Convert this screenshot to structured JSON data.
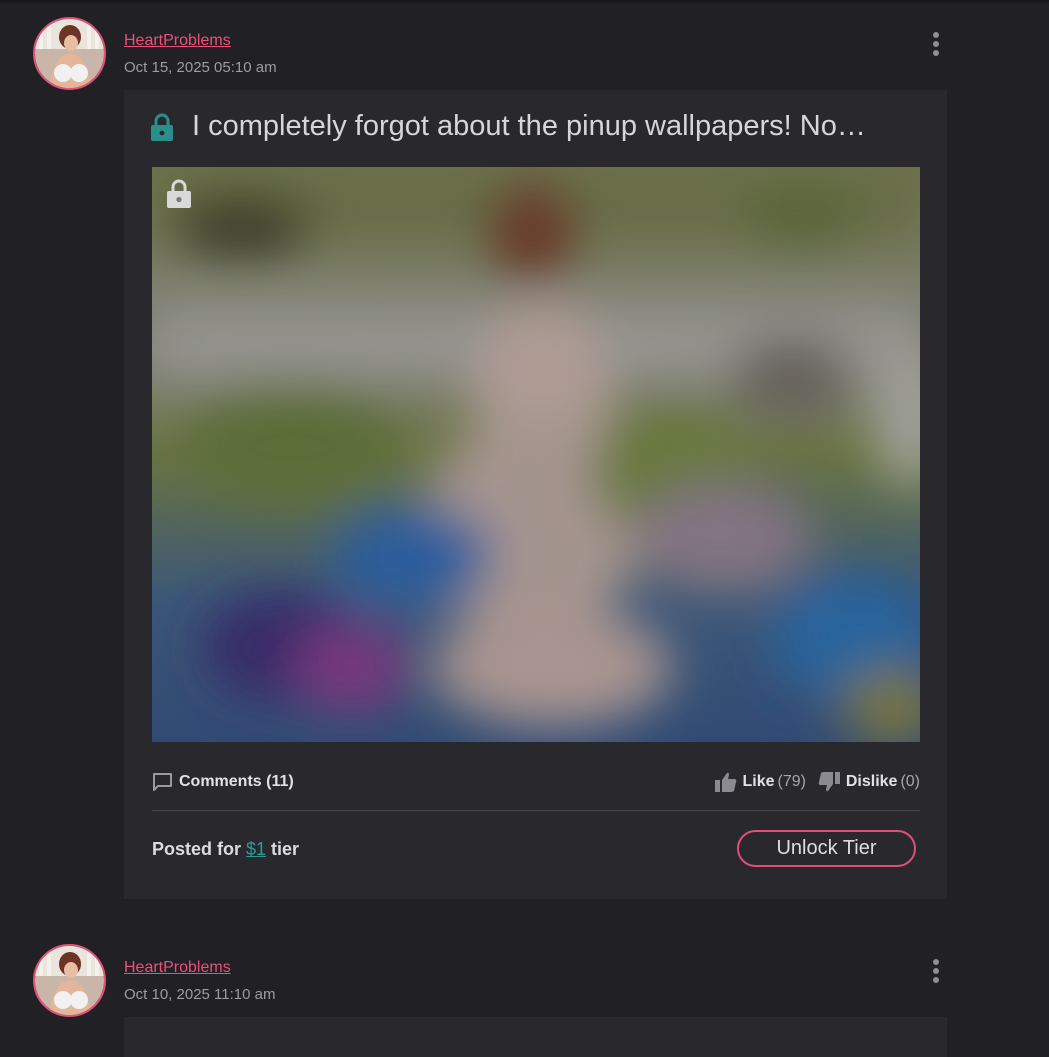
{
  "posts": [
    {
      "author": "HeartProblems",
      "date": "Oct 15, 2025 05:10 am",
      "title": "I completely forgot about the pinup wallpapers! No…",
      "comments_label": "Comments (11)",
      "like_label": "Like",
      "like_count": "(79)",
      "dislike_label": "Dislike",
      "dislike_count": "(0)",
      "posted_for_prefix": "Posted for ",
      "tier_price": "$1",
      "posted_for_suffix": " tier",
      "unlock_label": "Unlock Tier"
    },
    {
      "author": "HeartProblems",
      "date": "Oct 10, 2025 11:10 am"
    }
  ],
  "colors": {
    "background": "#212024",
    "card": "#29292d",
    "accent_pink": "#ef4e7c",
    "accent_teal": "#2a9c97"
  },
  "icons": {
    "lock": "lock-icon",
    "comment": "comment-icon",
    "like": "thumbs-up-icon",
    "dislike": "thumbs-down-icon",
    "menu": "more-vertical-icon"
  }
}
